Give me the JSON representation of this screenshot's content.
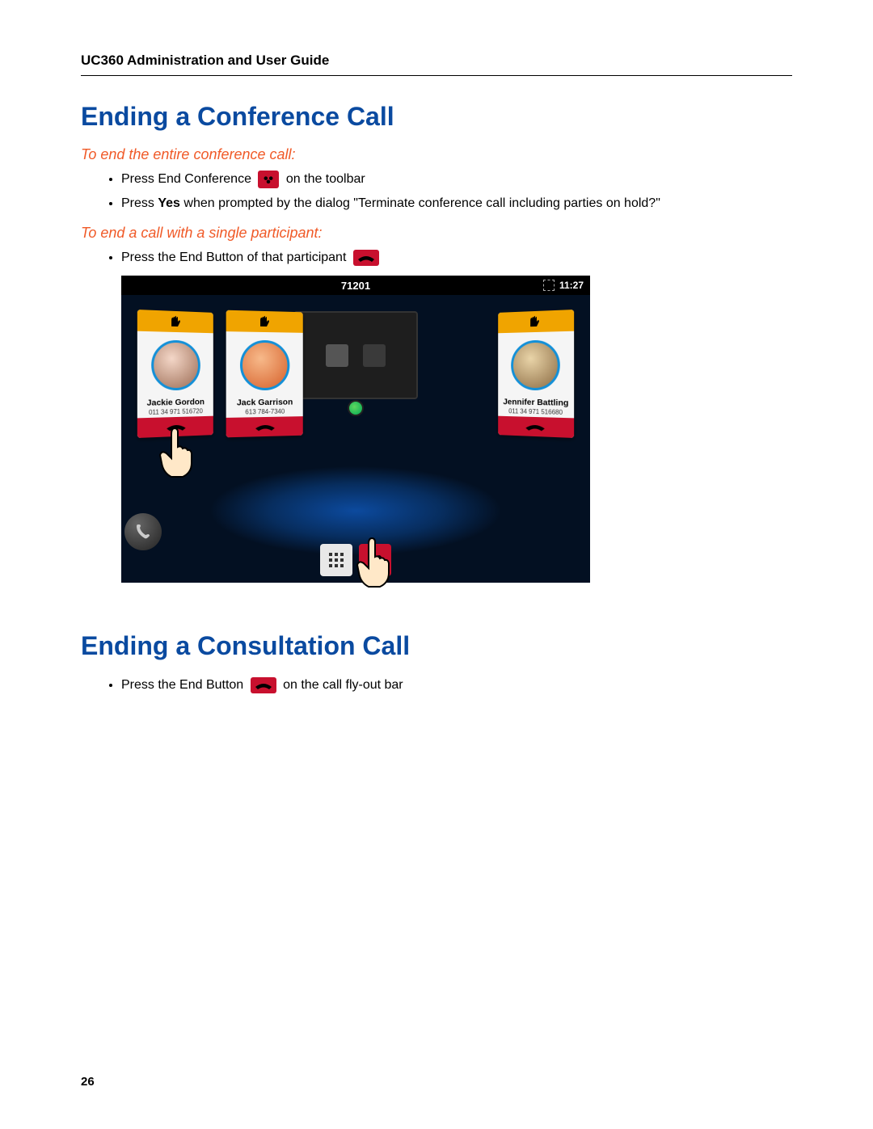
{
  "header": {
    "title": "UC360 Administration and User Guide"
  },
  "section1": {
    "heading": "Ending a Conference Call",
    "sub1": "To end the entire conference call:",
    "bullet1a_pre": "Press End Conference ",
    "bullet1a_post": " on the toolbar",
    "bullet1b_pre": "Press ",
    "bullet1b_bold": "Yes",
    "bullet1b_post": " when prompted by the dialog \"Terminate conference call including parties on hold?\"",
    "sub2": "To end a call with a single participant:",
    "bullet2a_pre": "Press the End Button of that participant "
  },
  "screenshot": {
    "status_number": "71201",
    "status_time": "11:27",
    "cards": [
      {
        "name": "Jackie Gordon",
        "number": "011 34 971 516720"
      },
      {
        "name": "Jack Garrison",
        "number": "613 784-7340"
      },
      {
        "name": "Jennifer Battling",
        "number": "011 34 971 516680"
      }
    ]
  },
  "section2": {
    "heading": "Ending a Consultation Call",
    "bullet_pre": "Press the End Button ",
    "bullet_post": " on the call fly-out bar"
  },
  "page_number": "26"
}
